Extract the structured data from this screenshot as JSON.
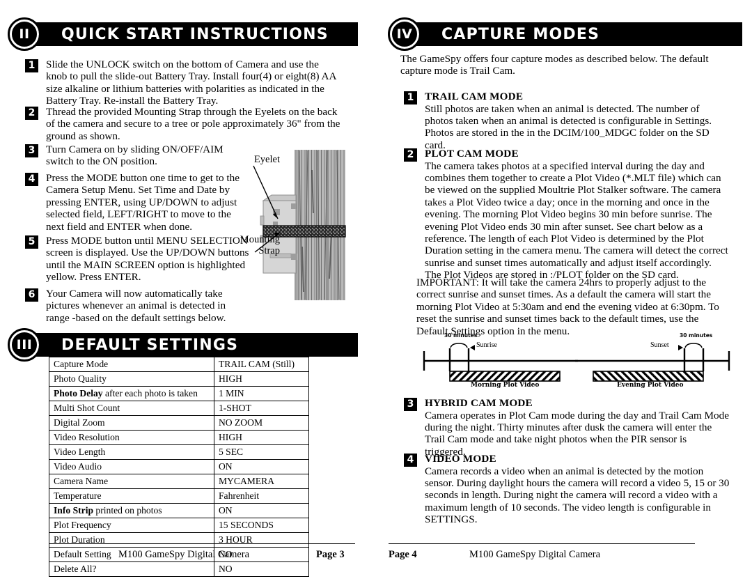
{
  "left_page": {
    "section_quick_start": {
      "numeral": "II",
      "title": "QUICK START INSTRUCTIONS",
      "steps": [
        {
          "num": "1",
          "text": "Slide the UNLOCK switch on the bottom of Camera and use the knob to pull the slide-out Battery Tray. Install four(4) or eight(8) AA size alkaline or lithium batteries with polarities as indicated in the Battery Tray. Re-install the Battery Tray."
        },
        {
          "num": "2",
          "text": "Thread the provided Mounting Strap through the Eyelets on the back of the camera and secure to a tree or pole approximately 36\" from the ground as shown."
        },
        {
          "num": "3",
          "text": "Turn Camera on by sliding ON/OFF/AIM switch to the ON position."
        },
        {
          "num": "4",
          "text": "Press the MODE button one time to get to the Camera Setup Menu. Set Time and Date by pressing ENTER, using UP/DOWN to adjust selected field, LEFT/RIGHT to move to the next field and ENTER when done."
        },
        {
          "num": "5",
          "text": "Press MODE button until MENU SELECTION screen is displayed.  Use the UP/DOWN buttons until the MAIN SCREEN option is highlighted yellow.  Press ENTER."
        },
        {
          "num": "6",
          "text": "Your Camera will now automatically take pictures whenever an animal is detected in range -based on the default settings below."
        }
      ]
    },
    "illustration": {
      "label_eyelet": "Eyelet",
      "label_mounting_strap": "Mounting\nStrap"
    },
    "section_default_settings": {
      "numeral": "III",
      "title": "DEFAULT SETTINGS",
      "rows": [
        {
          "label": "Capture Mode",
          "label_bold": "",
          "value": "TRAIL CAM (Still)"
        },
        {
          "label": "Photo Quality",
          "label_bold": "",
          "value": "HIGH"
        },
        {
          "label": " after each photo is taken",
          "label_bold": "Photo Delay",
          "value": "1 MIN"
        },
        {
          "label": "Multi Shot Count",
          "label_bold": "",
          "value": "1-SHOT"
        },
        {
          "label": "Digital Zoom",
          "label_bold": "",
          "value": "NO ZOOM"
        },
        {
          "label": "Video Resolution",
          "label_bold": "",
          "value": "HIGH"
        },
        {
          "label": "Video Length",
          "label_bold": "",
          "value": "5 SEC"
        },
        {
          "label": "Video Audio",
          "label_bold": "",
          "value": "ON"
        },
        {
          "label": "Camera Name",
          "label_bold": "",
          "value": "MYCAMERA"
        },
        {
          "label": "Temperature",
          "label_bold": "",
          "value": "Fahrenheit"
        },
        {
          "label": " printed on photos",
          "label_bold": "Info Strip",
          "value": "ON"
        },
        {
          "label": "Plot Frequency",
          "label_bold": "",
          "value": "15 SECONDS"
        },
        {
          "label": "Plot Duration",
          "label_bold": "",
          "value": "3 HOUR"
        },
        {
          "label": "Default Setting",
          "label_bold": "",
          "value": "NO"
        },
        {
          "label": "Delete All?",
          "label_bold": "",
          "value": "NO"
        }
      ]
    },
    "footer": {
      "title": "M100 GameSpy Digital Camera",
      "page": "Page 3"
    }
  },
  "right_page": {
    "section_capture_modes": {
      "numeral": "IV",
      "title": "CAPTURE MODES",
      "intro": "The GameSpy offers four capture modes as described below. The default capture mode is Trail Cam.",
      "modes": [
        {
          "num": "1",
          "title": "TRAIL CAM MODE",
          "text": "Still photos are taken when an animal is detected. The number of photos taken when an animal is detected is configurable in Settings. Photos are stored in the in the DCIM/100_MDGC folder on the SD card."
        },
        {
          "num": "2",
          "title": "PLOT CAM MODE",
          "text": "The camera takes photos at a specified interval during the day and combines them together to create a Plot Video (*.MLT file) which can be viewed on the supplied Moultrie Plot Stalker software. The camera takes a Plot Video twice a day; once in the morning and once in the evening.  The morning Plot Video begins 30 min before sunrise. The evening Plot Video ends 30 min after sunset.  See chart below as a reference.  The length of each Plot Video is determined by the Plot Duration setting in the camera menu.  The camera will detect the correct sunrise and sunset times automatically and adjust itself accordingly. The Plot Videos are stored in :/PLOT folder on the SD card."
        },
        {
          "num": "3",
          "title": "HYBRID CAM MODE",
          "text": "Camera operates in Plot Cam mode during the day and Trail Cam Mode during the night. Thirty minutes after dusk the camera will enter the Trail Cam mode and take night photos when the PIR sensor is triggered."
        },
        {
          "num": "4",
          "title": "VIDEO MODE",
          "text": "Camera records a video when an animal is detected by the motion sensor. During daylight hours the camera will record a video 5, 15 or 30 seconds in length. During night the camera will record a video with a maximum length of 10 seconds. The video length is configurable in SETTINGS."
        }
      ],
      "important": "IMPORTANT:  It will take the camera 24hrs to properly adjust to the correct sunrise and sunset times. As a default the camera will start the morning Plot Video at 5:30am and end the evening video at 6:30pm. To reset the sunrise and sunset times back to the default times, use the Default Settings option in the menu."
    },
    "footer": {
      "title": "M100 GameSpy Digital Camera",
      "page": "Page 4"
    }
  },
  "chart_data": {
    "type": "timeline",
    "title": "",
    "panels": [
      {
        "name": "morning",
        "caption": "Morning Plot Video",
        "bracket_label": "30 minutes",
        "event_label": "Sunrise",
        "event_marker": "arrow-left",
        "bar_hatch": "forward-diagonal",
        "description": "Morning Plot Video bar begins 30 minutes before sunrise and continues to the right."
      },
      {
        "name": "evening",
        "caption": "Evening Plot Video",
        "bracket_label": "30 minutes",
        "event_label": "Sunset",
        "event_marker": "arrow-right",
        "bar_hatch": "back-diagonal",
        "description": "Evening Plot Video bar ends 30 minutes after sunset."
      }
    ]
  }
}
